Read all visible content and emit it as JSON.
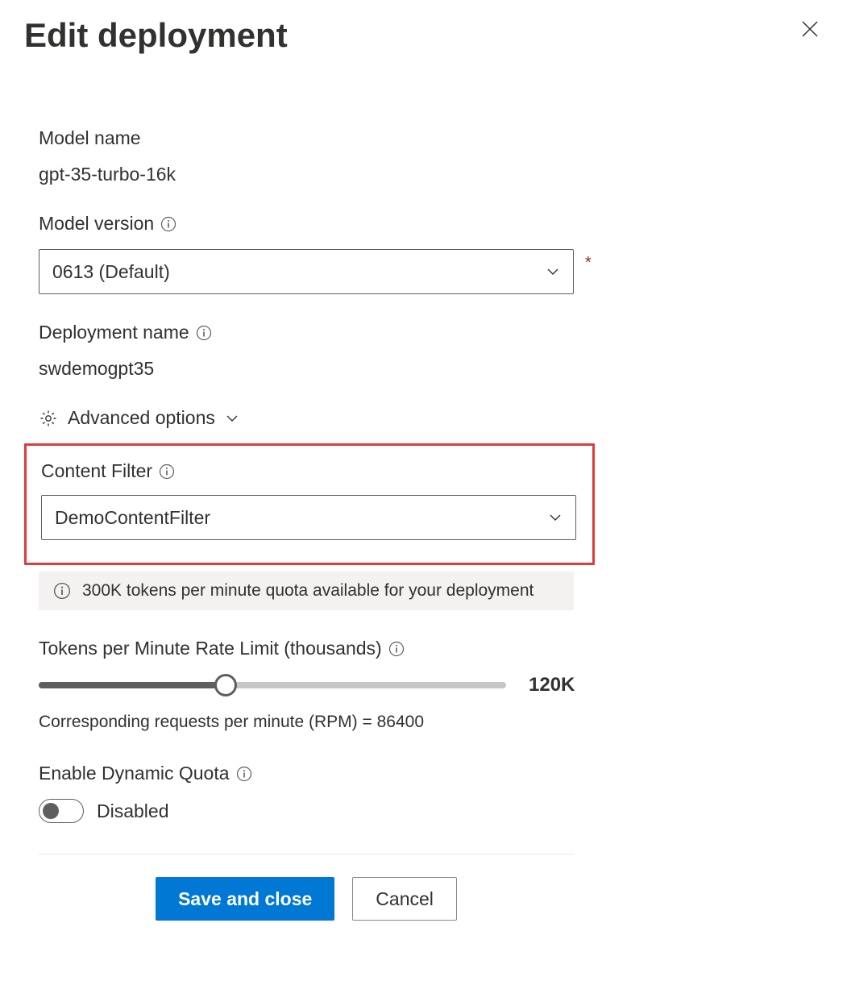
{
  "header": {
    "title": "Edit deployment"
  },
  "model_name": {
    "label": "Model name",
    "value": "gpt-35-turbo-16k"
  },
  "model_version": {
    "label": "Model version",
    "selected": "0613 (Default)",
    "required_mark": "*"
  },
  "deployment_name": {
    "label": "Deployment name",
    "value": "swdemogpt35"
  },
  "advanced": {
    "label": "Advanced options"
  },
  "content_filter": {
    "label": "Content Filter",
    "selected": "DemoContentFilter"
  },
  "quota_notice": {
    "text": "300K tokens per minute quota available for your deployment"
  },
  "rate_limit": {
    "label": "Tokens per Minute Rate Limit (thousands)",
    "value_display": "120K",
    "fill_percent": 40
  },
  "rpm": {
    "text": "Corresponding requests per minute (RPM) = 86400"
  },
  "dynamic_quota": {
    "label": "Enable Dynamic Quota",
    "state_label": "Disabled"
  },
  "buttons": {
    "save": "Save and close",
    "cancel": "Cancel"
  }
}
